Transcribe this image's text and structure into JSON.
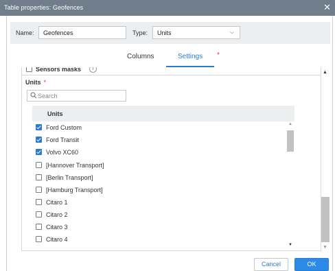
{
  "dialog": {
    "title": "Table properties: Geofences",
    "close_glyph": "✕"
  },
  "form": {
    "name_label": "Name:",
    "name_value": "Geofences",
    "type_label": "Type:",
    "type_value": "Units"
  },
  "tabs": [
    {
      "label": "Columns",
      "active": false
    },
    {
      "label": "Settings",
      "active": true
    }
  ],
  "required_marker": "*",
  "settings": {
    "sensors_masks_label": "Sensors masks",
    "info_glyph": "i",
    "units_title": "Units",
    "search_placeholder": "Search",
    "list_header": "Units",
    "items": [
      {
        "label": "Ford Custom",
        "checked": true
      },
      {
        "label": "Ford Transit",
        "checked": true
      },
      {
        "label": "Volvo XC60",
        "checked": true
      },
      {
        "label": "[Hannover Transport]",
        "checked": false
      },
      {
        "label": "[Berlin Transport]",
        "checked": false
      },
      {
        "label": "[Hamburg Transport]",
        "checked": false
      },
      {
        "label": "Citaro 1",
        "checked": false
      },
      {
        "label": "Citaro 2",
        "checked": false
      },
      {
        "label": "Citaro 3",
        "checked": false
      },
      {
        "label": "Citaro 4",
        "checked": false
      }
    ]
  },
  "buttons": {
    "cancel": "Cancel",
    "ok": "OK"
  },
  "colors": {
    "titlebar": "#6f7e8a",
    "accent": "#2b7bd6",
    "required": "#e53935"
  }
}
